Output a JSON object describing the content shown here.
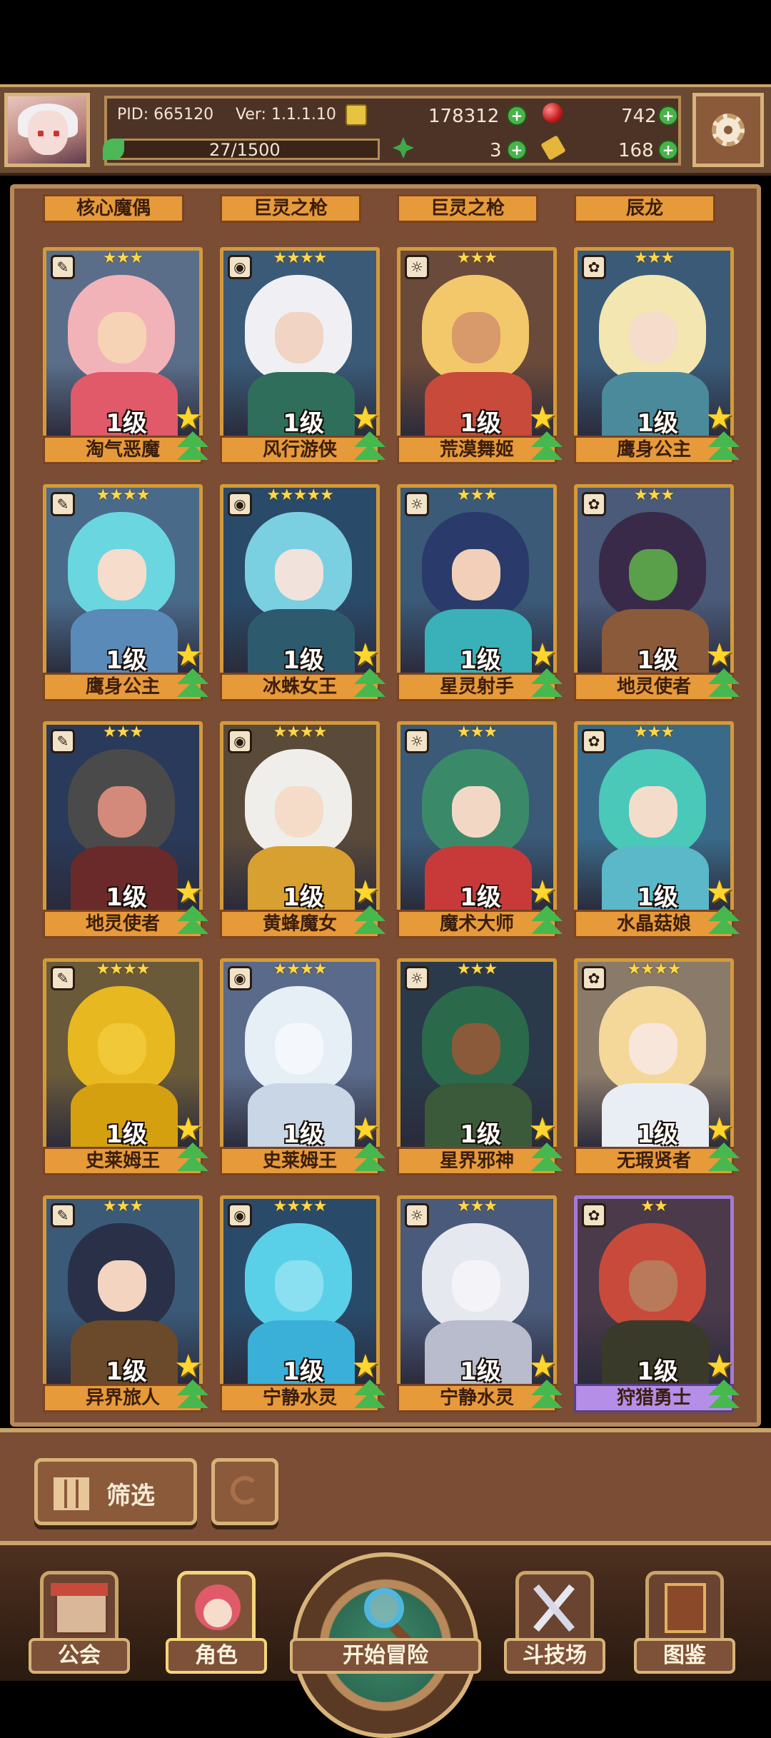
{
  "header": {
    "pid": "PID: 665120",
    "version": "Ver: 1.1.1.10",
    "xp": "27/1500",
    "gold": "178312",
    "gems": "742",
    "clover": "3",
    "tickets": "168"
  },
  "top_row_labels": [
    "核心魔偶",
    "巨灵之枪",
    "巨灵之枪",
    "辰龙"
  ],
  "cards": [
    {
      "name": "淘气恶魔",
      "level": "1级",
      "stars": "★★★",
      "hair": "#f2b3b8",
      "face": "#f5d3b4",
      "body": "#e05a6a",
      "bg": "#5a6e8a"
    },
    {
      "name": "风行游侠",
      "level": "1级",
      "stars": "★★★★",
      "hair": "#f0f0f4",
      "face": "#f2d4c4",
      "body": "#2e6e5a",
      "bg": "#3a5a78"
    },
    {
      "name": "荒漠舞姬",
      "level": "1级",
      "stars": "★★★",
      "hair": "#f3c86a",
      "face": "#d89a6a",
      "body": "#c84a3a",
      "bg": "#6a4a3a"
    },
    {
      "name": "鹰身公主",
      "level": "1级",
      "stars": "★★★",
      "hair": "#f3e6b0",
      "face": "#f6dccb",
      "body": "#4a8a9a",
      "bg": "#3a5a78"
    },
    {
      "name": "鹰身公主",
      "level": "1级",
      "stars": "★★★★",
      "hair": "#6ad6e0",
      "face": "#f6dccb",
      "body": "#5a8ab8",
      "bg": "#4a6a8a"
    },
    {
      "name": "冰蛛女王",
      "level": "1级",
      "stars": "★★★★★",
      "hair": "#7ad0e0",
      "face": "#f2e2dc",
      "body": "#2e5a6e",
      "bg": "#2a4a6a"
    },
    {
      "name": "星灵射手",
      "level": "1级",
      "stars": "★★★",
      "hair": "#2a3a6a",
      "face": "#f2cfb8",
      "body": "#3ab0b8",
      "bg": "#3a5a78"
    },
    {
      "name": "地灵使者",
      "level": "1级",
      "stars": "★★★",
      "hair": "#3a2a4a",
      "face": "#5aa04a",
      "body": "#8a5a3a",
      "bg": "#4a5a78"
    },
    {
      "name": "地灵使者",
      "level": "1级",
      "stars": "★★★",
      "hair": "#4a4a4a",
      "face": "#d48a7a",
      "body": "#6a2a2a",
      "bg": "#2a3a5a"
    },
    {
      "name": "黄蜂魔女",
      "level": "1级",
      "stars": "★★★★",
      "hair": "#f0eeea",
      "face": "#f4dcc8",
      "body": "#d8a030",
      "bg": "#5a4a3a"
    },
    {
      "name": "魔术大师",
      "level": "1级",
      "stars": "★★★",
      "hair": "#3a8a6a",
      "face": "#f2d8c4",
      "body": "#c83a3a",
      "bg": "#3a5a78"
    },
    {
      "name": "水晶菇娘",
      "level": "1级",
      "stars": "★★★",
      "hair": "#4ac8b8",
      "face": "#f4dccb",
      "body": "#5ab8c8",
      "bg": "#3a6a8a"
    },
    {
      "name": "史莱姆王",
      "level": "1级",
      "stars": "★★★★",
      "hair": "#e8b820",
      "face": "#f0c838",
      "body": "#d4a010",
      "bg": "#6a5a3a"
    },
    {
      "name": "史莱姆王",
      "level": "1级",
      "stars": "★★★★",
      "hair": "#e6eef6",
      "face": "#f4f8fc",
      "body": "#c8d6e6",
      "bg": "#5a6a8a"
    },
    {
      "name": "星界邪神",
      "level": "1级",
      "stars": "★★★",
      "hair": "#2a6a4a",
      "face": "#8a5a3a",
      "body": "#3a5a3a",
      "bg": "#2a3a4a"
    },
    {
      "name": "无瑕贤者",
      "level": "1级",
      "stars": "★★★★",
      "hair": "#f3d89a",
      "face": "#f8e6da",
      "body": "#e8eef4",
      "bg": "#8a7a6a"
    },
    {
      "name": "异界旅人",
      "level": "1级",
      "stars": "★★★",
      "hair": "#2a3048",
      "face": "#f2d4c0",
      "body": "#6a4a2a",
      "bg": "#3a5a78"
    },
    {
      "name": "宁静水灵",
      "level": "1级",
      "stars": "★★★★",
      "hair": "#5ad0e8",
      "face": "#8ae0f0",
      "body": "#3ab0d8",
      "bg": "#2a4a6a"
    },
    {
      "name": "宁静水灵",
      "level": "1级",
      "stars": "★★★",
      "hair": "#e6e8f0",
      "face": "#f4f4f8",
      "body": "#b8bccc",
      "bg": "#4a5a7a"
    },
    {
      "name": "狩猎勇士",
      "level": "1级",
      "stars": "★★",
      "hair": "#c84a3a",
      "face": "#b87a5a",
      "body": "#3a3a2a",
      "bg": "#4a3a4a",
      "purple": true
    }
  ],
  "filter": {
    "label": "筛选"
  },
  "nav": {
    "guild": "公会",
    "character": "角色",
    "adventure": "开始冒险",
    "arena": "斗技场",
    "codex": "图鉴"
  }
}
